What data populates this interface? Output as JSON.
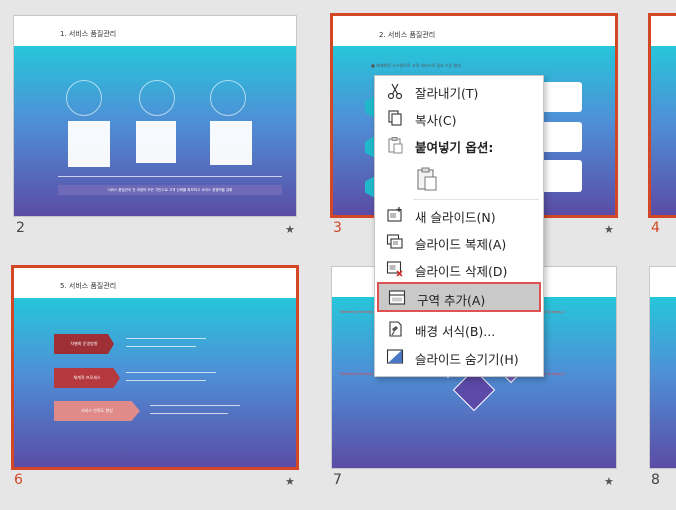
{
  "slides": [
    {
      "number": "2",
      "title": "1. 서비스 품질관리",
      "footer": "서비스 품질관리 전 과정의 모든 기반으로 고객 신뢰를 확보하고 서비스 경쟁력을 강화",
      "selected": false
    },
    {
      "number": "3",
      "title": "2. 서비스 품질관리",
      "subtitle": "■ 체계화된 시스템으로 고객 서비스의 질과 수준 향상",
      "selected": true
    },
    {
      "number": "4",
      "title": "",
      "selected": true
    },
    {
      "number": "6",
      "title": "5. 서비스 품질관리",
      "arrows": [
        "차별화 운영방향",
        "체계적 프로세스",
        "서비스 만족도 향상"
      ],
      "selected": true
    },
    {
      "number": "7",
      "title": "",
      "labels": [
        "Marketing Strategy 1",
        "Marketing Strategy 2",
        "Marketing Strategy 3",
        "Marketing Strategy 4"
      ],
      "selected": false
    },
    {
      "number": "8",
      "title": "",
      "selected": false
    }
  ],
  "star": "★",
  "context_menu": {
    "items": [
      {
        "label": "잘라내기(T)",
        "icon": "scissors-icon"
      },
      {
        "label": "복사(C)",
        "icon": "copy-icon"
      },
      {
        "label": "붙여넣기 옵션:",
        "icon": "paste-icon",
        "bold": true
      },
      {
        "label": "",
        "icon": "paste-clipboard-icon"
      },
      {
        "label": "새 슬라이드(N)",
        "icon": "new-slide-icon"
      },
      {
        "label": "슬라이드 복제(A)",
        "icon": "duplicate-slide-icon"
      },
      {
        "label": "슬라이드 삭제(D)",
        "icon": "delete-slide-icon"
      },
      {
        "label": "구역 추가(A)",
        "icon": "add-section-icon",
        "highlighted": true
      },
      {
        "label": "배경 서식(B)...",
        "icon": "format-background-icon"
      },
      {
        "label": "슬라이드 숨기기(H)",
        "icon": "hide-slide-icon"
      }
    ]
  },
  "colors": {
    "selection": "#d24726",
    "accent": "#26c6da",
    "highlight": "#e05252"
  }
}
